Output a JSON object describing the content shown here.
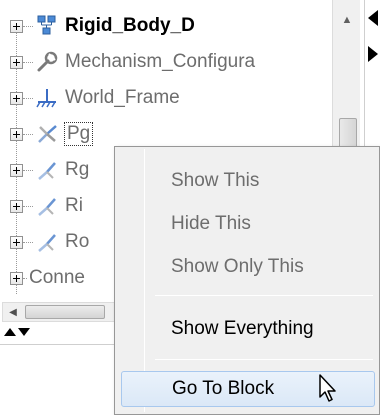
{
  "tree": {
    "items": [
      {
        "label": "Rigid_Body_D",
        "icon": "rigid-body-blocks-icon",
        "bold": true
      },
      {
        "label": "Mechanism_Configura",
        "icon": "wrench-icon",
        "bold": false
      },
      {
        "label": "World_Frame",
        "icon": "ground-frame-icon",
        "bold": false
      },
      {
        "label": "Pg",
        "icon": "frame-axes-icon",
        "bold": false,
        "selected": true
      },
      {
        "label": "Rg",
        "icon": "frame-axes-icon",
        "bold": false
      },
      {
        "label": "Ri",
        "icon": "frame-axes-icon",
        "bold": false
      },
      {
        "label": "Ro",
        "icon": "frame-axes-icon",
        "bold": false
      },
      {
        "label": "Conne",
        "icon": "",
        "bold": false
      }
    ]
  },
  "context_menu": {
    "items": [
      {
        "label": "Show This",
        "enabled": false
      },
      {
        "label": "Hide This",
        "enabled": false
      },
      {
        "label": "Show Only This",
        "enabled": false
      },
      {
        "label": "Show Everything",
        "enabled": true
      },
      {
        "label": "Go To Block",
        "enabled": true,
        "hovered": true
      }
    ]
  },
  "colors": {
    "disabled_text": "#6d6d6d",
    "enabled_text": "#000000",
    "menu_background": "#f0f0f0",
    "hover_highlight": "#dbe8f7"
  },
  "cursor": {
    "icon": "arrow-cursor-icon"
  }
}
